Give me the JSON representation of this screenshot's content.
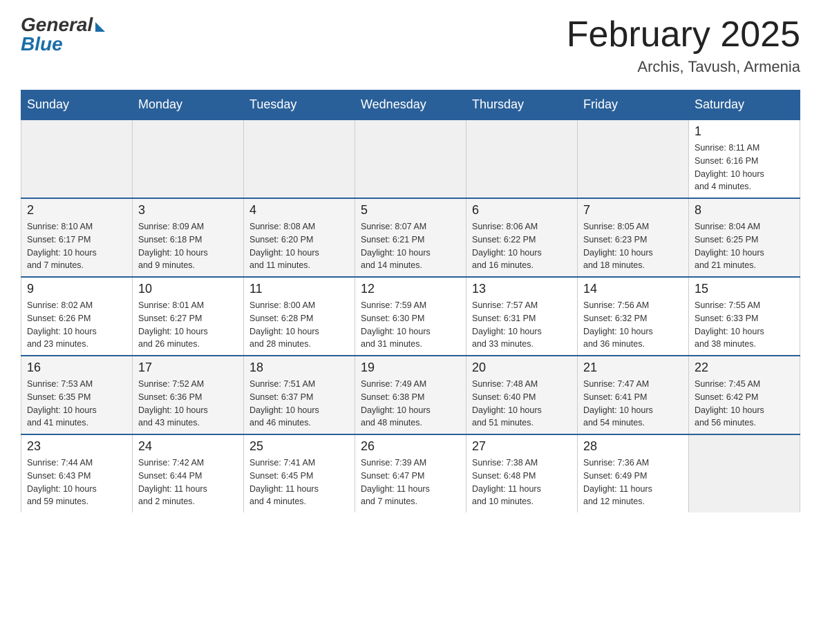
{
  "header": {
    "logo_general": "General",
    "logo_blue": "Blue",
    "month_title": "February 2025",
    "location": "Archis, Tavush, Armenia"
  },
  "weekdays": [
    "Sunday",
    "Monday",
    "Tuesday",
    "Wednesday",
    "Thursday",
    "Friday",
    "Saturday"
  ],
  "weeks": [
    [
      {
        "day": "",
        "info": ""
      },
      {
        "day": "",
        "info": ""
      },
      {
        "day": "",
        "info": ""
      },
      {
        "day": "",
        "info": ""
      },
      {
        "day": "",
        "info": ""
      },
      {
        "day": "",
        "info": ""
      },
      {
        "day": "1",
        "info": "Sunrise: 8:11 AM\nSunset: 6:16 PM\nDaylight: 10 hours\nand 4 minutes."
      }
    ],
    [
      {
        "day": "2",
        "info": "Sunrise: 8:10 AM\nSunset: 6:17 PM\nDaylight: 10 hours\nand 7 minutes."
      },
      {
        "day": "3",
        "info": "Sunrise: 8:09 AM\nSunset: 6:18 PM\nDaylight: 10 hours\nand 9 minutes."
      },
      {
        "day": "4",
        "info": "Sunrise: 8:08 AM\nSunset: 6:20 PM\nDaylight: 10 hours\nand 11 minutes."
      },
      {
        "day": "5",
        "info": "Sunrise: 8:07 AM\nSunset: 6:21 PM\nDaylight: 10 hours\nand 14 minutes."
      },
      {
        "day": "6",
        "info": "Sunrise: 8:06 AM\nSunset: 6:22 PM\nDaylight: 10 hours\nand 16 minutes."
      },
      {
        "day": "7",
        "info": "Sunrise: 8:05 AM\nSunset: 6:23 PM\nDaylight: 10 hours\nand 18 minutes."
      },
      {
        "day": "8",
        "info": "Sunrise: 8:04 AM\nSunset: 6:25 PM\nDaylight: 10 hours\nand 21 minutes."
      }
    ],
    [
      {
        "day": "9",
        "info": "Sunrise: 8:02 AM\nSunset: 6:26 PM\nDaylight: 10 hours\nand 23 minutes."
      },
      {
        "day": "10",
        "info": "Sunrise: 8:01 AM\nSunset: 6:27 PM\nDaylight: 10 hours\nand 26 minutes."
      },
      {
        "day": "11",
        "info": "Sunrise: 8:00 AM\nSunset: 6:28 PM\nDaylight: 10 hours\nand 28 minutes."
      },
      {
        "day": "12",
        "info": "Sunrise: 7:59 AM\nSunset: 6:30 PM\nDaylight: 10 hours\nand 31 minutes."
      },
      {
        "day": "13",
        "info": "Sunrise: 7:57 AM\nSunset: 6:31 PM\nDaylight: 10 hours\nand 33 minutes."
      },
      {
        "day": "14",
        "info": "Sunrise: 7:56 AM\nSunset: 6:32 PM\nDaylight: 10 hours\nand 36 minutes."
      },
      {
        "day": "15",
        "info": "Sunrise: 7:55 AM\nSunset: 6:33 PM\nDaylight: 10 hours\nand 38 minutes."
      }
    ],
    [
      {
        "day": "16",
        "info": "Sunrise: 7:53 AM\nSunset: 6:35 PM\nDaylight: 10 hours\nand 41 minutes."
      },
      {
        "day": "17",
        "info": "Sunrise: 7:52 AM\nSunset: 6:36 PM\nDaylight: 10 hours\nand 43 minutes."
      },
      {
        "day": "18",
        "info": "Sunrise: 7:51 AM\nSunset: 6:37 PM\nDaylight: 10 hours\nand 46 minutes."
      },
      {
        "day": "19",
        "info": "Sunrise: 7:49 AM\nSunset: 6:38 PM\nDaylight: 10 hours\nand 48 minutes."
      },
      {
        "day": "20",
        "info": "Sunrise: 7:48 AM\nSunset: 6:40 PM\nDaylight: 10 hours\nand 51 minutes."
      },
      {
        "day": "21",
        "info": "Sunrise: 7:47 AM\nSunset: 6:41 PM\nDaylight: 10 hours\nand 54 minutes."
      },
      {
        "day": "22",
        "info": "Sunrise: 7:45 AM\nSunset: 6:42 PM\nDaylight: 10 hours\nand 56 minutes."
      }
    ],
    [
      {
        "day": "23",
        "info": "Sunrise: 7:44 AM\nSunset: 6:43 PM\nDaylight: 10 hours\nand 59 minutes."
      },
      {
        "day": "24",
        "info": "Sunrise: 7:42 AM\nSunset: 6:44 PM\nDaylight: 11 hours\nand 2 minutes."
      },
      {
        "day": "25",
        "info": "Sunrise: 7:41 AM\nSunset: 6:45 PM\nDaylight: 11 hours\nand 4 minutes."
      },
      {
        "day": "26",
        "info": "Sunrise: 7:39 AM\nSunset: 6:47 PM\nDaylight: 11 hours\nand 7 minutes."
      },
      {
        "day": "27",
        "info": "Sunrise: 7:38 AM\nSunset: 6:48 PM\nDaylight: 11 hours\nand 10 minutes."
      },
      {
        "day": "28",
        "info": "Sunrise: 7:36 AM\nSunset: 6:49 PM\nDaylight: 11 hours\nand 12 minutes."
      },
      {
        "day": "",
        "info": ""
      }
    ]
  ]
}
